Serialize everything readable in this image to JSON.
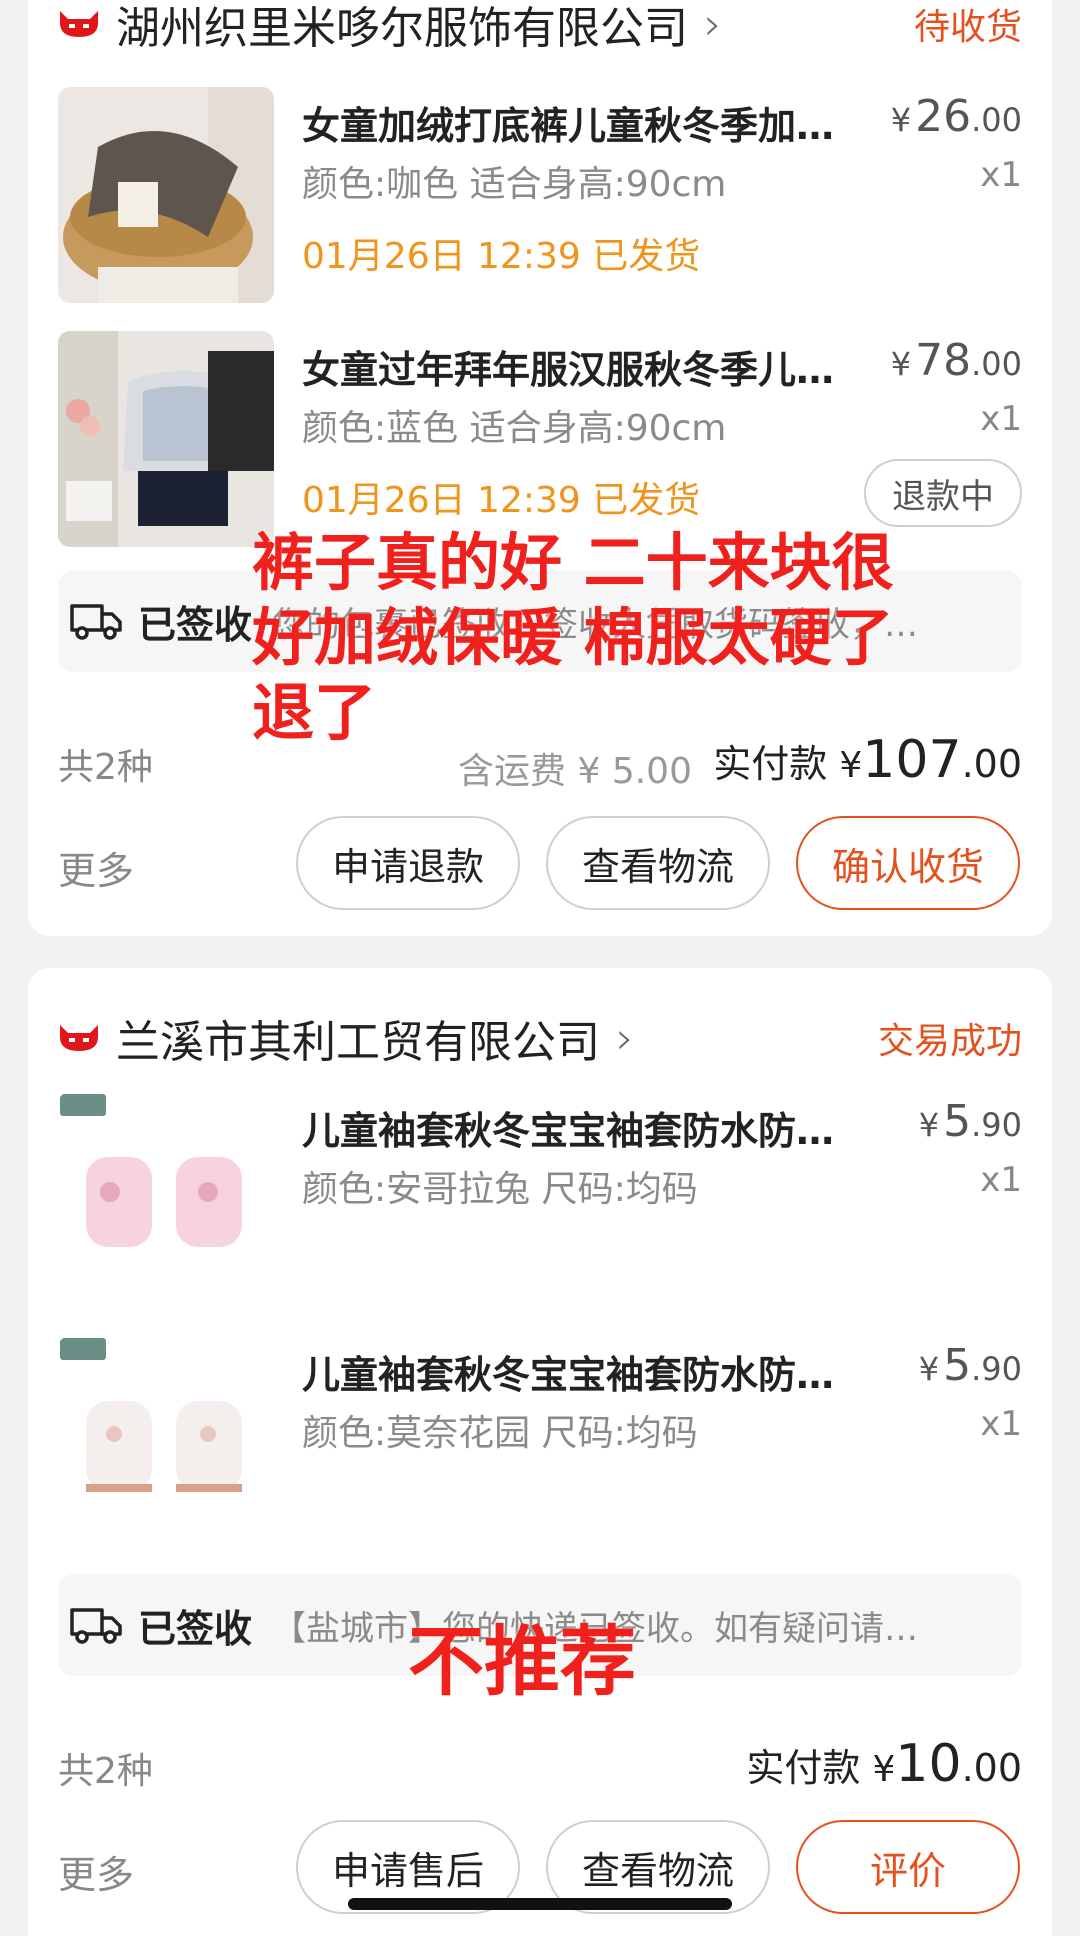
{
  "orders": [
    {
      "shop_name": "湖州织里米哆尔服饰有限公司",
      "status": "待收货",
      "items": [
        {
          "title": "女童加绒打底裤儿童秋冬季加…",
          "spec": "颜色:咖色 适合身高:90cm",
          "ship_status": "01月26日 12:39 已发货",
          "price_currency": "¥",
          "price_int": "26",
          "price_dec": ".00",
          "qty": "x1"
        },
        {
          "title": "女童过年拜年服汉服秋冬季儿…",
          "spec": "颜色:蓝色 适合身高:90cm",
          "ship_status": "01月26日 12:39 已发货",
          "price_currency": "¥",
          "price_int": "78",
          "price_dec": ".00",
          "qty": "x1",
          "badge": "退款中"
        }
      ],
      "logistics_label": "已签收",
      "logistics_text": "您的包裹已签收，签收人凭取货码签收，…",
      "count": "共2种",
      "shipping_fee": "含运费 ¥ 5.00",
      "paid_label": "实付款",
      "paid_currency": "¥",
      "paid_int": "107",
      "paid_dec": ".00",
      "more": "更多",
      "buttons": [
        "申请退款",
        "查看物流",
        "确认收货"
      ]
    },
    {
      "shop_name": "兰溪市其利工贸有限公司",
      "status": "交易成功",
      "items": [
        {
          "title": "儿童袖套秋冬宝宝袖套防水防…",
          "spec": "颜色:安哥拉兔 尺码:均码",
          "price_currency": "¥",
          "price_int": "5",
          "price_dec": ".90",
          "qty": "x1"
        },
        {
          "title": "儿童袖套秋冬宝宝袖套防水防…",
          "spec": "颜色:莫奈花园 尺码:均码",
          "price_currency": "¥",
          "price_int": "5",
          "price_dec": ".90",
          "qty": "x1"
        }
      ],
      "logistics_label": "已签收",
      "logistics_text": "【盐城市】您的快递已签收。如有疑问请…",
      "count": "共2种",
      "paid_label": "实付款",
      "paid_currency": "¥",
      "paid_int": "10",
      "paid_dec": ".00",
      "more": "更多",
      "buttons": [
        "申请售后",
        "查看物流",
        "评价"
      ]
    }
  ],
  "annotations": {
    "note1_line1": "裤子真的好 二十来块很",
    "note1_line2": "好加绒保暖 棉服太硬了",
    "note1_line3": "退了",
    "note2": "不推荐"
  },
  "colors": {
    "accent": "#e5511d",
    "ship_orange": "#f0941c",
    "annotation_red": "#f0201c"
  },
  "icons": [
    "tmall-cat-logo-icon",
    "chevron-right-icon",
    "truck-icon"
  ]
}
